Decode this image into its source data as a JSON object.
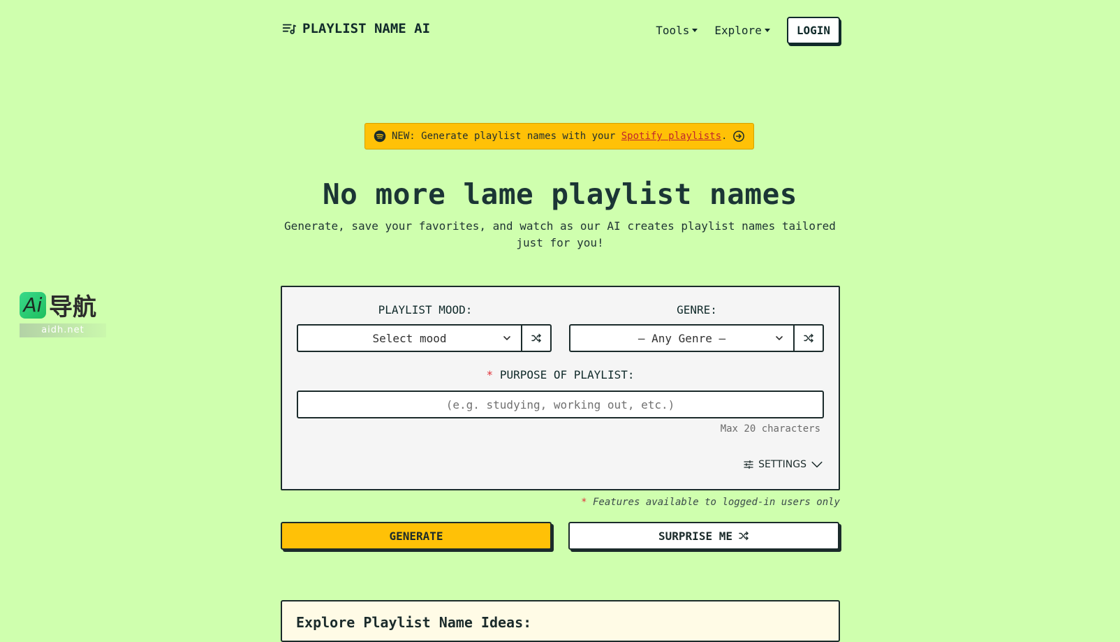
{
  "nav": {
    "brand": "PLAYLIST NAME AI",
    "brand_icon": "playlist-music-icon",
    "links": [
      {
        "label": "Tools"
      },
      {
        "label": "Explore"
      }
    ],
    "login_label": "LOGIN"
  },
  "banner": {
    "icon": "spotify-icon",
    "prefix": "NEW: Generate playlist names with your ",
    "link_text": "Spotify playlists",
    "suffix": ".",
    "arrow_icon": "arrow-right-circle-icon",
    "color": "#ffc107"
  },
  "hero": {
    "title": "No more lame playlist names",
    "subtitle": "Generate, save your favorites, and watch as our AI creates playlist names tailored just for you!"
  },
  "watermark": {
    "text": "导航",
    "domain": "aidh.net"
  },
  "form": {
    "mood_label": "PLAYLIST MOOD:",
    "mood_value": "Select mood",
    "genre_label": "GENRE:",
    "genre_value": "– Any Genre –",
    "required_mark": "*",
    "purpose_label": "PURPOSE OF PLAYLIST:",
    "purpose_placeholder": "(e.g. studying, working out, etc.)",
    "purpose_hint": "Max 20 characters",
    "settings_label": "SETTINGS"
  },
  "features_note": {
    "mark": "*",
    "text": "Features available to logged-in users only"
  },
  "actions": {
    "generate_label": "GENERATE",
    "surprise_label": "SURPRISE ME"
  },
  "explore": {
    "title": "Explore Playlist Name Ideas:"
  },
  "colors": {
    "background": "#cfffae",
    "accent": "#ffc107",
    "text": "#1b2b2b",
    "required": "#e0323a"
  }
}
